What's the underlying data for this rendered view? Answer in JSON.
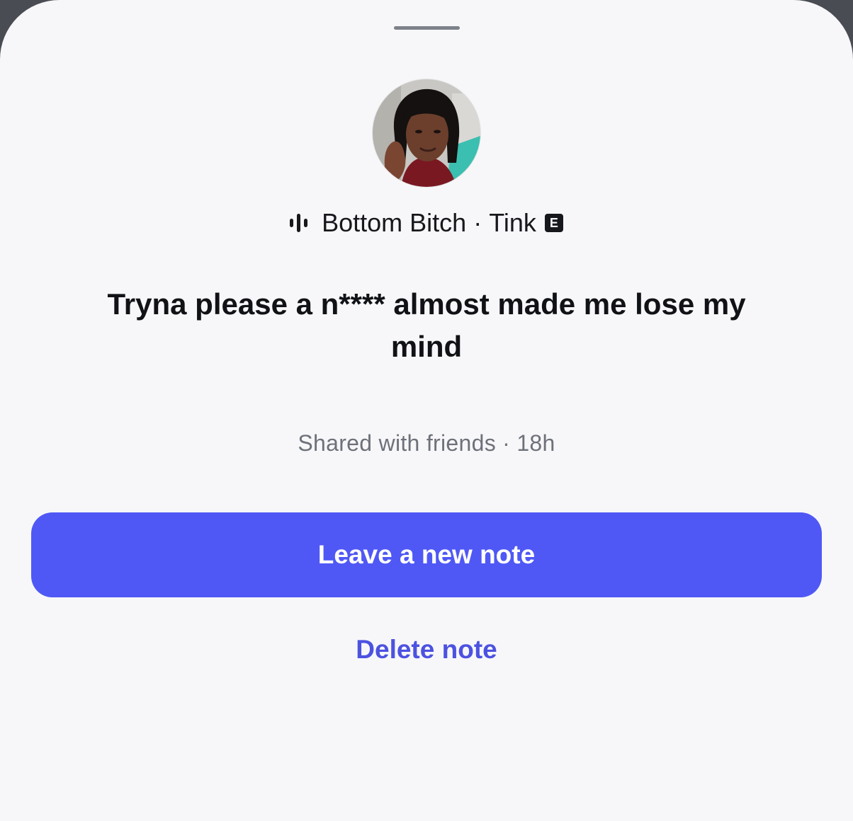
{
  "note": {
    "song": {
      "icon": "audio-bars-icon",
      "title": "Bottom Bitch",
      "separator": "·",
      "artist": "Tink",
      "explicit_badge": "E"
    },
    "text": "Tryna please a n**** almost made me lose my mind",
    "meta": "Shared with friends · 18h"
  },
  "actions": {
    "primary_label": "Leave a new note",
    "secondary_label": "Delete note"
  },
  "colors": {
    "sheet_background": "#f7f7f9",
    "primary_button": "#4f58f5",
    "delete_text": "#4c52e0",
    "meta_text": "#6e717a"
  }
}
